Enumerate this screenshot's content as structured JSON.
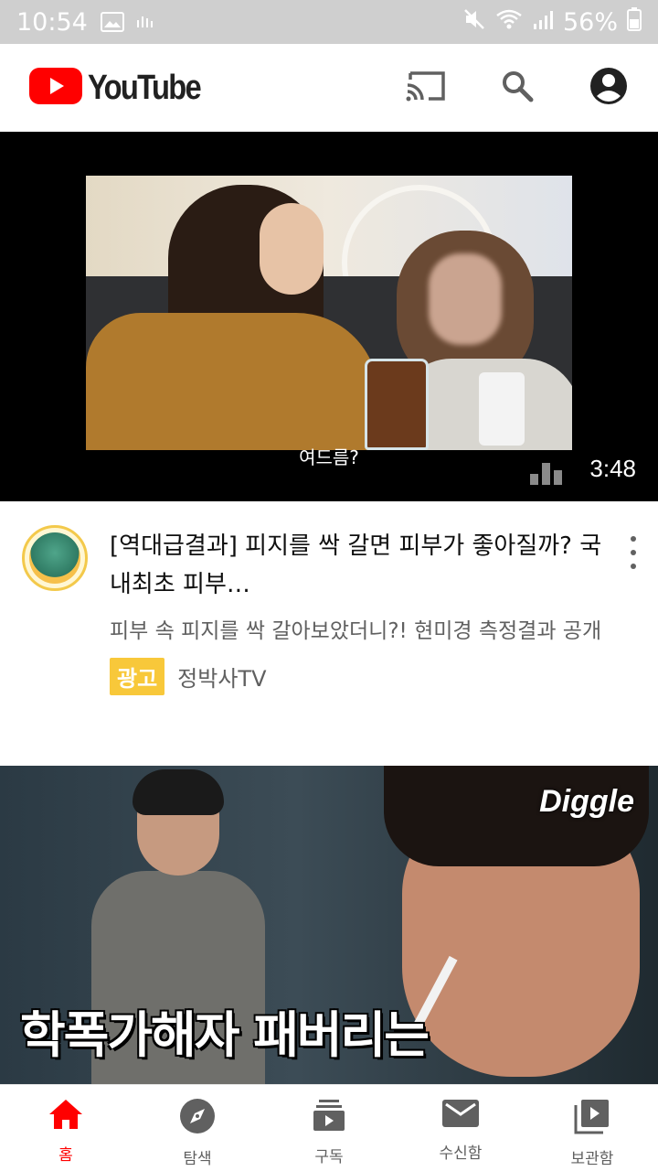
{
  "status_bar": {
    "time": "10:54",
    "battery": "56%"
  },
  "header": {
    "logo_text": "YouTube",
    "icons": [
      "cast-icon",
      "search-icon",
      "account-icon"
    ]
  },
  "featured_video": {
    "subtitle": "여드름?",
    "duration": "3:48",
    "title": "[역대급결과] 피지를 싹 갈면 피부가 좋아질까? 국내최초 피부…",
    "description": "피부 속 피지를 싹 갈아보았더니?! 현미경 측정결과 공개",
    "ad_badge": "광고",
    "channel": "정박사TV"
  },
  "second_video": {
    "watermark": "Diggle",
    "caption": "학폭가해자 패버리는"
  },
  "bottom_nav": {
    "items": [
      {
        "label": "홈",
        "icon": "home-icon",
        "active": true
      },
      {
        "label": "탐색",
        "icon": "explore-icon",
        "active": false
      },
      {
        "label": "구독",
        "icon": "subscriptions-icon",
        "active": false
      },
      {
        "label": "수신함",
        "icon": "inbox-icon",
        "active": false
      },
      {
        "label": "보관함",
        "icon": "library-icon",
        "active": false
      }
    ]
  },
  "colors": {
    "brand_red": "#ff0000",
    "ad_yellow": "#f8c83a"
  }
}
